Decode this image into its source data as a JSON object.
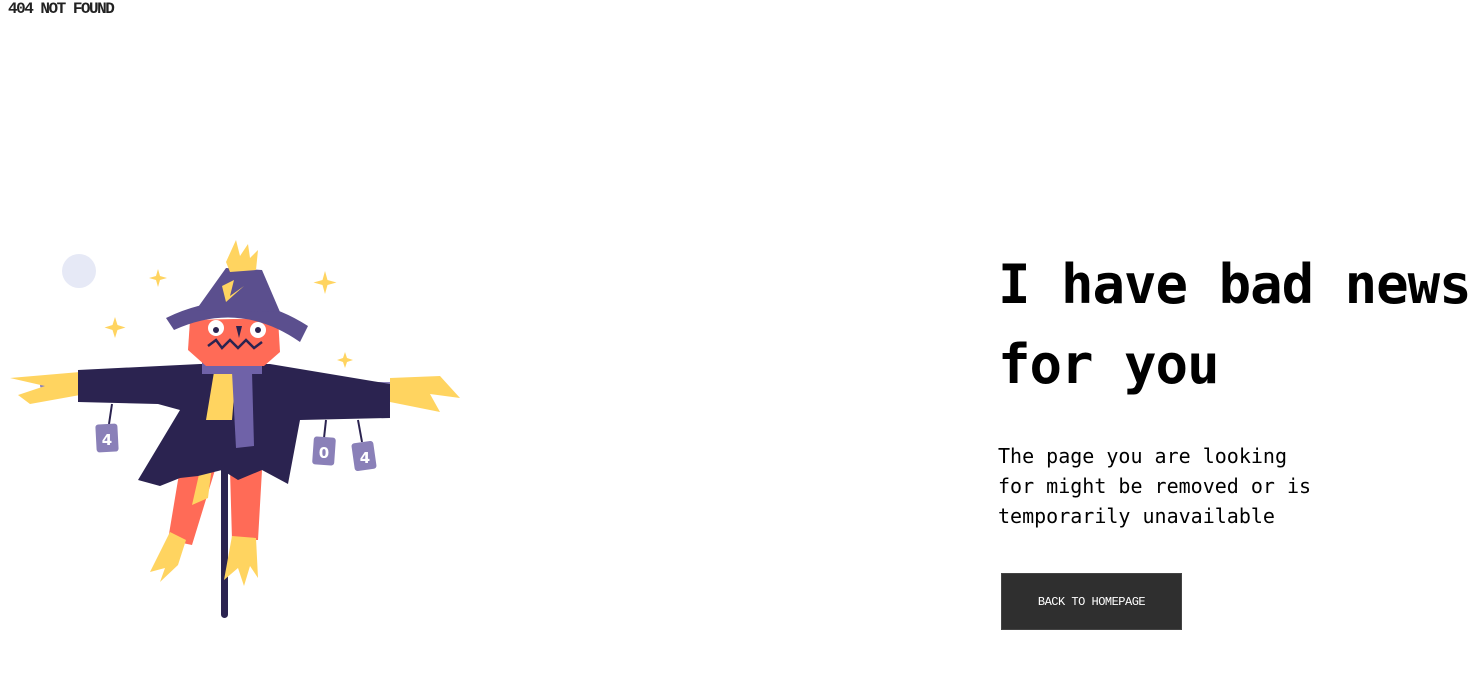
{
  "header": {
    "title": "404 NOT FOUND"
  },
  "main": {
    "headline_line1": "I have bad news",
    "headline_line2": "for you",
    "message_line1": "The page you are looking",
    "message_line2": "for might be removed or is",
    "message_line3": "temporarily unavailable",
    "home_button_label": "BACK TO HOMEPAGE"
  },
  "illustration": {
    "subject": "scarecrow-illustration",
    "can_left": "4",
    "can_middle": "0",
    "can_right": "4"
  },
  "colors": {
    "background": "#ffffff",
    "button_bg": "#2f2f2f",
    "button_text": "#ffffff",
    "hat": "#5b4f8e",
    "coat": "#2b2350",
    "face": "#ff6b57",
    "straw": "#ffd460",
    "moon": "#e6e9f6"
  }
}
